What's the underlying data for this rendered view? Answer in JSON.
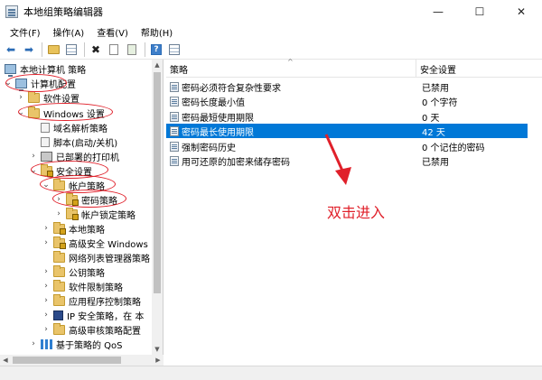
{
  "window": {
    "title": "本地组策略编辑器",
    "controls": {
      "minimize": "—",
      "maximize": "☐",
      "close": "✕"
    }
  },
  "menu": [
    "文件(F)",
    "操作(A)",
    "查看(V)",
    "帮助(H)"
  ],
  "toolbar": {
    "icons": [
      "back-arrow-icon",
      "forward-arrow-icon",
      "folder-up-icon",
      "show-hide-tree-icon",
      "delete-icon",
      "properties-icon",
      "export-list-icon",
      "help-icon",
      "show-hide-action-pane-icon"
    ]
  },
  "tree": [
    {
      "label": "本地计算机 策略",
      "icon": "computer"
    },
    {
      "label": "计算机配置",
      "icon": "computer",
      "expanded": true
    },
    {
      "label": "软件设置",
      "icon": "folder"
    },
    {
      "label": "Windows 设置",
      "icon": "folder",
      "expanded": true
    },
    {
      "label": "域名解析策略",
      "icon": "doc"
    },
    {
      "label": "脚本(启动/关机)",
      "icon": "doc"
    },
    {
      "label": "已部署的打印机",
      "icon": "printer"
    },
    {
      "label": "安全设置",
      "icon": "lockfolder",
      "expanded": true
    },
    {
      "label": "帐户策略",
      "icon": "folder",
      "expanded": true
    },
    {
      "label": "密码策略",
      "icon": "lockfolder",
      "selected": true
    },
    {
      "label": "帐户锁定策略",
      "icon": "lockfolder"
    },
    {
      "label": "本地策略",
      "icon": "lockfolder"
    },
    {
      "label": "高级安全 Windows",
      "icon": "lockfolder"
    },
    {
      "label": "网络列表管理器策略",
      "icon": "folder"
    },
    {
      "label": "公钥策略",
      "icon": "folder"
    },
    {
      "label": "软件限制策略",
      "icon": "folder"
    },
    {
      "label": "应用程序控制策略",
      "icon": "folder"
    },
    {
      "label": "IP 安全策略，在 本",
      "icon": "ip"
    },
    {
      "label": "高级审核策略配置",
      "icon": "folder"
    },
    {
      "label": "基于策略的 QoS",
      "icon": "chart"
    }
  ],
  "list": {
    "columns": [
      "策略",
      "安全设置"
    ],
    "rows": [
      {
        "name": "密码必须符合复杂性要求",
        "value": "已禁用"
      },
      {
        "name": "密码长度最小值",
        "value": "0 个字符"
      },
      {
        "name": "密码最短使用期限",
        "value": "0 天"
      },
      {
        "name": "密码最长使用期限",
        "value": "42 天",
        "selected": true
      },
      {
        "name": "强制密码历史",
        "value": "0 个记住的密码"
      },
      {
        "name": "用可还原的加密来储存密码",
        "value": "已禁用"
      }
    ]
  },
  "annotation": {
    "text": "双击进入",
    "color": "#e0202a"
  },
  "colors": {
    "selection": "#0078d7",
    "annotation_red": "#e0202a",
    "folder": "#e9c46a"
  }
}
